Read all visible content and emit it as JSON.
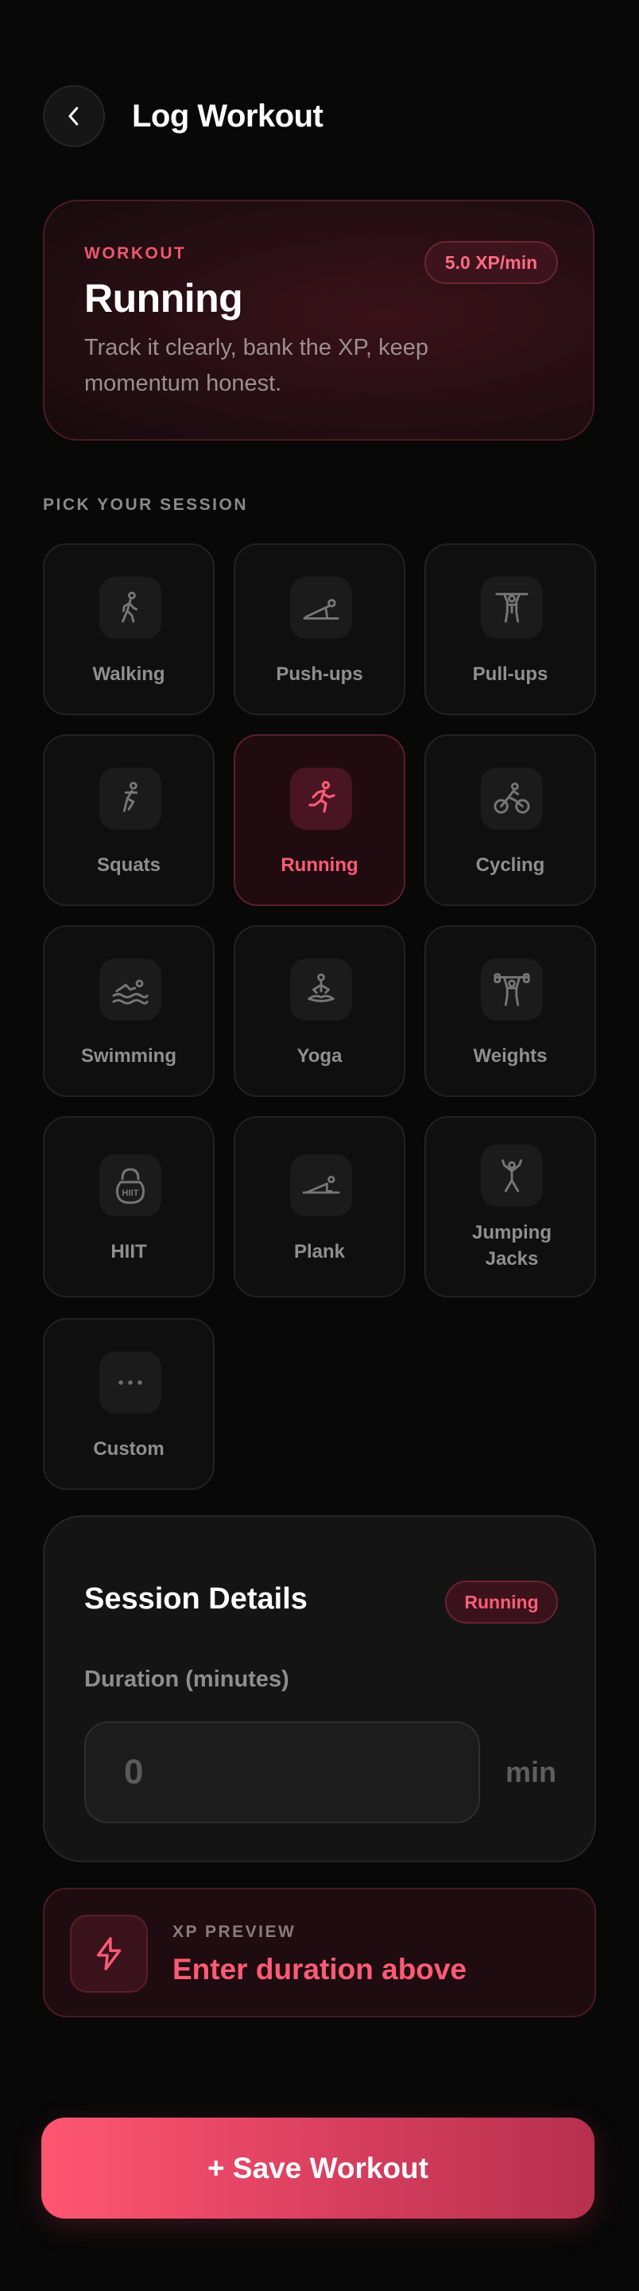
{
  "header": {
    "title": "Log Workout",
    "back_icon": "chevron-left-icon"
  },
  "hero": {
    "eyebrow": "WORKOUT",
    "title": "Running",
    "subtitle": "Track it clearly, bank the XP, keep momentum honest.",
    "xp_rate": "5.0 XP/min"
  },
  "session_picker": {
    "label": "PICK YOUR SESSION",
    "selected": "Running",
    "items": [
      {
        "label": "Walking",
        "icon": "walking-icon"
      },
      {
        "label": "Push-ups",
        "icon": "push-up-icon"
      },
      {
        "label": "Pull-ups",
        "icon": "pull-up-icon"
      },
      {
        "label": "Squats",
        "icon": "squat-icon"
      },
      {
        "label": "Running",
        "icon": "running-icon"
      },
      {
        "label": "Cycling",
        "icon": "cycling-icon"
      },
      {
        "label": "Swimming",
        "icon": "swimming-icon"
      },
      {
        "label": "Yoga",
        "icon": "yoga-icon"
      },
      {
        "label": "Weights",
        "icon": "weights-icon"
      },
      {
        "label": "HIIT",
        "icon": "kettlebell-icon",
        "icon_text": "HIIT"
      },
      {
        "label": "Plank",
        "icon": "plank-icon"
      },
      {
        "label": "Jumping Jacks",
        "icon": "jumping-jacks-icon"
      },
      {
        "label": "Custom",
        "icon": "more-icon"
      }
    ]
  },
  "details": {
    "title": "Session Details",
    "badge": "Running",
    "duration_label": "Duration (minutes)",
    "duration_value": "",
    "duration_placeholder": "0",
    "unit": "min"
  },
  "xp_preview": {
    "eyebrow": "XP PREVIEW",
    "value": "Enter duration above",
    "icon": "lightning-bolt-icon"
  },
  "save_button": {
    "label": "+ Save Workout"
  },
  "colors": {
    "background": "#080808",
    "accent": "#ff5a75",
    "tile_bg": "#0f0f0f",
    "tile_active_bg": "#200c10",
    "muted_text": "#8f8f8f"
  }
}
